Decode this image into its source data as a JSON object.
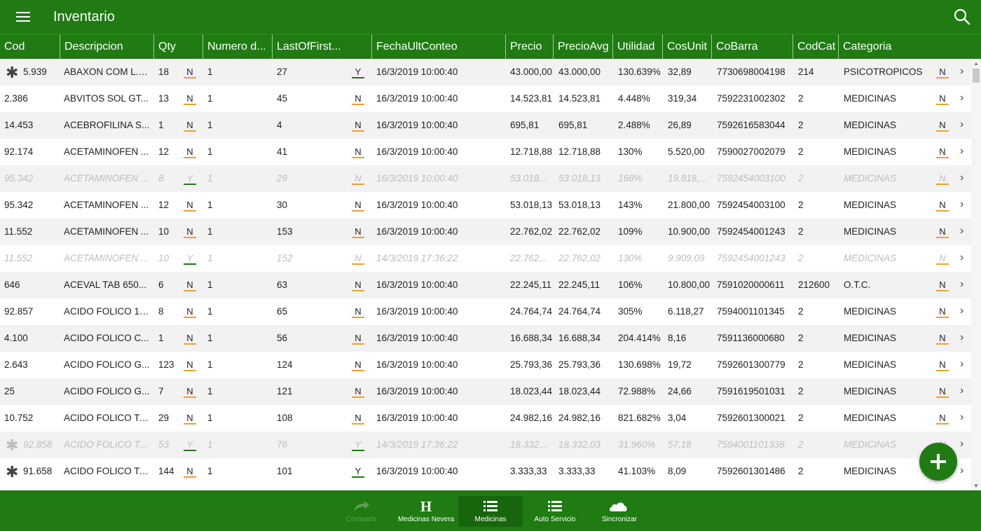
{
  "app": {
    "title": "Inventario"
  },
  "colors": {
    "primary": "#1f7b12",
    "flag_n": "#f0a030",
    "flag_y": "#1f7b12"
  },
  "icons": {
    "menu": "hamburger-menu-icon",
    "search": "search-icon",
    "row_marker": "asterisk-icon",
    "row_nav": "chevron-right-icon"
  },
  "columns": [
    "Cod",
    "Descripcion",
    "Qty",
    "Numero d...",
    "LastOfFirst...",
    "FechaUltConteo",
    "Precio",
    "PrecioAvg",
    "Utilidad",
    "CosUnit",
    "CoBarra",
    "CodCat",
    "Categoria"
  ],
  "rows": [
    {
      "star": true,
      "cod": "5.939",
      "desc": "ABAXON COM L.P...",
      "qty": "18",
      "f1": "N",
      "num": "1",
      "last": "27",
      "f2": "Y",
      "fecha": "16/3/2019 10:00:40",
      "precio": "43.000,00",
      "avg": "43.000,00",
      "util": "130.639%",
      "cos": "32,89",
      "barra": "7730698004198",
      "codcat": "214",
      "cat": "PSICOTROPICOS",
      "f3": "N",
      "dim": false
    },
    {
      "star": false,
      "cod": "2.386",
      "desc": "ABVITOS SOL GT...",
      "qty": "13",
      "f1": "N",
      "num": "1",
      "last": "45",
      "f2": "N",
      "fecha": "16/3/2019 10:00:40",
      "precio": "14.523,81",
      "avg": "14.523,81",
      "util": "4.448%",
      "cos": "319,34",
      "barra": "7592231002302",
      "codcat": "2",
      "cat": "MEDICINAS",
      "f3": "N",
      "dim": false
    },
    {
      "star": false,
      "cod": "14.453",
      "desc": "ACEBROFILINA S...",
      "qty": "1",
      "f1": "N",
      "num": "1",
      "last": "4",
      "f2": "N",
      "fecha": "16/3/2019 10:00:40",
      "precio": "695,81",
      "avg": "695,81",
      "util": "2.488%",
      "cos": "26,89",
      "barra": "7592616583044",
      "codcat": "2",
      "cat": "MEDICINAS",
      "f3": "N",
      "dim": false
    },
    {
      "star": false,
      "cod": "92.174",
      "desc": "ACETAMINOFEN ...",
      "qty": "12",
      "f1": "N",
      "num": "1",
      "last": "41",
      "f2": "N",
      "fecha": "16/3/2019 10:00:40",
      "precio": "12.718,88",
      "avg": "12.718,88",
      "util": "130%",
      "cos": "5.520,00",
      "barra": "7590027002079",
      "codcat": "2",
      "cat": "MEDICINAS",
      "f3": "N",
      "dim": false
    },
    {
      "star": false,
      "cod": "95.342",
      "desc": "ACETAMINOFEN ...",
      "qty": "8",
      "f1": "Y",
      "num": "1",
      "last": "29",
      "f2": "N",
      "fecha": "16/3/2019 10:00:40",
      "precio": "53.018...",
      "avg": "53.018,13",
      "util": "168%",
      "cos": "19.818,...",
      "barra": "7592454003100",
      "codcat": "2",
      "cat": "MEDICINAS",
      "f3": "N",
      "dim": true
    },
    {
      "star": false,
      "cod": "95.342",
      "desc": "ACETAMINOFEN ...",
      "qty": "12",
      "f1": "N",
      "num": "1",
      "last": "30",
      "f2": "N",
      "fecha": "16/3/2019 10:00:40",
      "precio": "53.018,13",
      "avg": "53.018,13",
      "util": "143%",
      "cos": "21.800,00",
      "barra": "7592454003100",
      "codcat": "2",
      "cat": "MEDICINAS",
      "f3": "N",
      "dim": false
    },
    {
      "star": false,
      "cod": "11.552",
      "desc": "ACETAMINOFEN ...",
      "qty": "10",
      "f1": "N",
      "num": "1",
      "last": "153",
      "f2": "N",
      "fecha": "16/3/2019 10:00:40",
      "precio": "22.762,02",
      "avg": "22.762,02",
      "util": "109%",
      "cos": "10.900,00",
      "barra": "7592454001243",
      "codcat": "2",
      "cat": "MEDICINAS",
      "f3": "N",
      "dim": false
    },
    {
      "star": false,
      "cod": "11.552",
      "desc": "ACETAMINOFEN ...",
      "qty": "10",
      "f1": "Y",
      "num": "1",
      "last": "152",
      "f2": "N",
      "fecha": "14/3/2019 17:36:22",
      "precio": "22.762...",
      "avg": "22.762,02",
      "util": "130%",
      "cos": "9.909,09",
      "barra": "7592454001243",
      "codcat": "2",
      "cat": "MEDICINAS",
      "f3": "N",
      "dim": true
    },
    {
      "star": false,
      "cod": "646",
      "desc": "ACEVAL TAB 650...",
      "qty": "6",
      "f1": "N",
      "num": "1",
      "last": "63",
      "f2": "N",
      "fecha": "16/3/2019 10:00:40",
      "precio": "22.245,11",
      "avg": "22.245,11",
      "util": "106%",
      "cos": "10.800,00",
      "barra": "7591020000611",
      "codcat": "212600",
      "cat": "O.T.C.",
      "f3": "N",
      "dim": false
    },
    {
      "star": false,
      "cod": "92.857",
      "desc": "ACIDO FOLICO 10...",
      "qty": "8",
      "f1": "N",
      "num": "1",
      "last": "65",
      "f2": "N",
      "fecha": "16/3/2019 10:00:40",
      "precio": "24.764,74",
      "avg": "24.764,74",
      "util": "305%",
      "cos": "6.118,27",
      "barra": "7594001101345",
      "codcat": "2",
      "cat": "MEDICINAS",
      "f3": "N",
      "dim": false
    },
    {
      "star": false,
      "cod": "4.100",
      "desc": "ACIDO FOLICO C...",
      "qty": "1",
      "f1": "N",
      "num": "1",
      "last": "56",
      "f2": "N",
      "fecha": "16/3/2019 10:00:40",
      "precio": "16.688,34",
      "avg": "16.688,34",
      "util": "204.414%",
      "cos": "8,16",
      "barra": "7591136000680",
      "codcat": "2",
      "cat": "MEDICINAS",
      "f3": "N",
      "dim": false
    },
    {
      "star": false,
      "cod": "2.643",
      "desc": "ACIDO FOLICO G...",
      "qty": "123",
      "f1": "N",
      "num": "1",
      "last": "124",
      "f2": "N",
      "fecha": "16/3/2019 10:00:40",
      "precio": "25.793,36",
      "avg": "25.793,36",
      "util": "130.698%",
      "cos": "19,72",
      "barra": "7592601300779",
      "codcat": "2",
      "cat": "MEDICINAS",
      "f3": "N",
      "dim": false
    },
    {
      "star": false,
      "cod": "25",
      "desc": "ACIDO FOLICO G...",
      "qty": "7",
      "f1": "N",
      "num": "1",
      "last": "121",
      "f2": "N",
      "fecha": "16/3/2019 10:00:40",
      "precio": "18.023,44",
      "avg": "18.023,44",
      "util": "72.988%",
      "cos": "24,66",
      "barra": "7591619501031",
      "codcat": "2",
      "cat": "MEDICINAS",
      "f3": "N",
      "dim": false
    },
    {
      "star": false,
      "cod": "10.752",
      "desc": "ACIDO FOLICO TA...",
      "qty": "29",
      "f1": "N",
      "num": "1",
      "last": "108",
      "f2": "N",
      "fecha": "16/3/2019 10:00:40",
      "precio": "24.982,16",
      "avg": "24.982,16",
      "util": "821.682%",
      "cos": "3,04",
      "barra": "7592601300021",
      "codcat": "2",
      "cat": "MEDICINAS",
      "f3": "N",
      "dim": false
    },
    {
      "star": true,
      "cod": "92.858",
      "desc": "ACIDO FOLICO T...",
      "qty": "53",
      "f1": "Y",
      "num": "1",
      "last": "76",
      "f2": "Y",
      "fecha": "14/3/2019 17:36:22",
      "precio": "18.332...",
      "avg": "18.332,03",
      "util": "31.960%",
      "cos": "57,18",
      "barra": "7594001101338",
      "codcat": "2",
      "cat": "MEDICINAS",
      "f3": "N",
      "dim": true
    },
    {
      "star": true,
      "cod": "91.658",
      "desc": "ACIDO FOLICO TA...",
      "qty": "144",
      "f1": "N",
      "num": "1",
      "last": "101",
      "f2": "Y",
      "fecha": "16/3/2019 10:00:40",
      "precio": "3.333,33",
      "avg": "3.333,33",
      "util": "41.103%",
      "cos": "8,09",
      "barra": "7592601301486",
      "codcat": "2",
      "cat": "MEDICINAS",
      "f3": "N",
      "dim": false
    }
  ],
  "nav": [
    {
      "label": "Compartir",
      "icon": "share-icon",
      "disabled": true,
      "active": false
    },
    {
      "label": "Medicinas Nevera",
      "icon": "hospital-h-icon",
      "disabled": false,
      "active": false
    },
    {
      "label": "Medicinas",
      "icon": "list-icon",
      "disabled": false,
      "active": true
    },
    {
      "label": "Auto Servicio",
      "icon": "list-icon",
      "disabled": false,
      "active": false
    },
    {
      "label": "Sincronizar",
      "icon": "cloud-icon",
      "disabled": false,
      "active": false
    }
  ]
}
